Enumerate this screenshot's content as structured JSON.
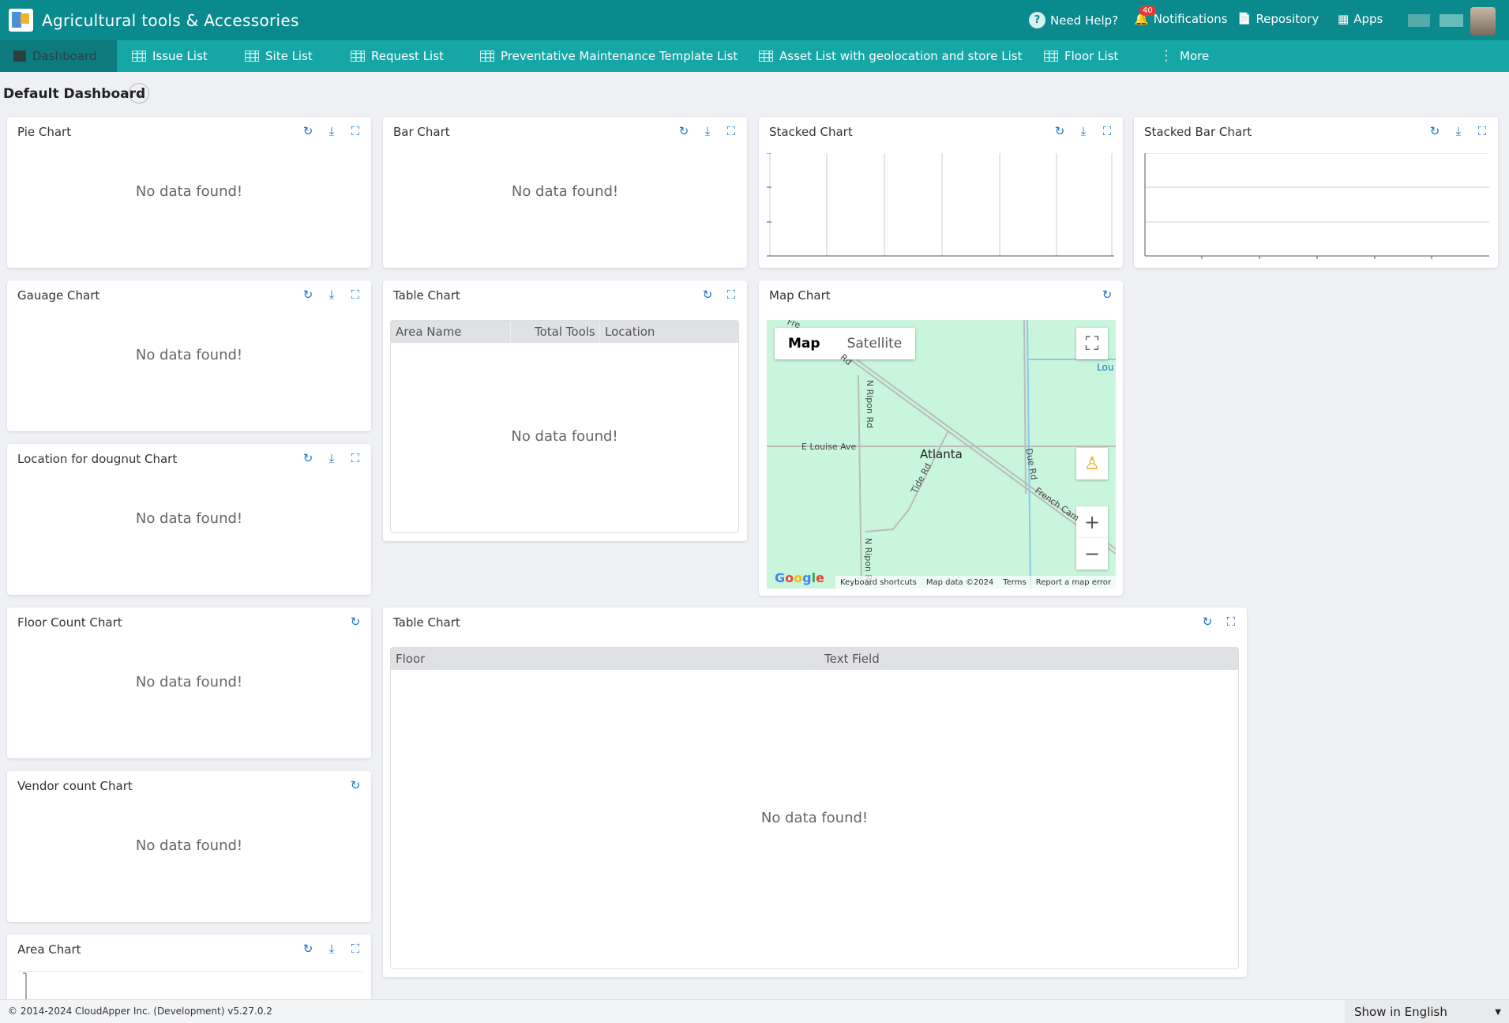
{
  "header": {
    "title": "Agricultural tools & Accessories",
    "need_help": "Need Help?",
    "notifications": "Notifications",
    "notif_count": "40",
    "repository": "Repository",
    "apps": "Apps"
  },
  "nav": {
    "tabs": [
      {
        "label": "Dashboard"
      },
      {
        "label": "Issue List"
      },
      {
        "label": "Site List"
      },
      {
        "label": "Request List"
      },
      {
        "label": "Preventative Maintenance Template List"
      },
      {
        "label": "Asset List with geolocation and store List"
      },
      {
        "label": "Floor List"
      },
      {
        "label": "More"
      }
    ]
  },
  "dashboard": {
    "title": "Default Dashboard"
  },
  "no_data": "No data found!",
  "cards": {
    "pie": "Pie Chart",
    "bar": "Bar Chart",
    "stacked": "Stacked Chart",
    "stacked_bar": "Stacked Bar Chart",
    "gauge": "Gauage Chart",
    "table1": "Table Chart",
    "map": "Map Chart",
    "doughnut": "Location for dougnut Chart",
    "floor_count": "Floor Count Chart",
    "table2": "Table Chart",
    "vendor": "Vendor count Chart",
    "area": "Area Chart"
  },
  "table1": {
    "columns": [
      "Area Name",
      "Total Tools",
      "Location"
    ]
  },
  "table2": {
    "columns": [
      "Floor",
      "Text Field"
    ]
  },
  "map": {
    "btn_map": "Map",
    "btn_satellite": "Satellite",
    "city": "Atlanta",
    "labels": {
      "louise": "E Louise Ave",
      "ripon1": "N Ripon Rd",
      "ripon2": "N Ripon Rd",
      "tide": "Tide Rd",
      "due": "Due Rd",
      "french": "French Cam",
      "lou": "Lou",
      "rd": "Rd",
      "fre": "Fre"
    },
    "google": "Google",
    "footer": [
      "Keyboard shortcuts",
      "Map data ©2024",
      "Terms",
      "Report a map error"
    ]
  },
  "footer": {
    "copyright": "© 2014-2024 CloudApper Inc. (Development) v5.27.0.2",
    "language": "Show in English"
  }
}
